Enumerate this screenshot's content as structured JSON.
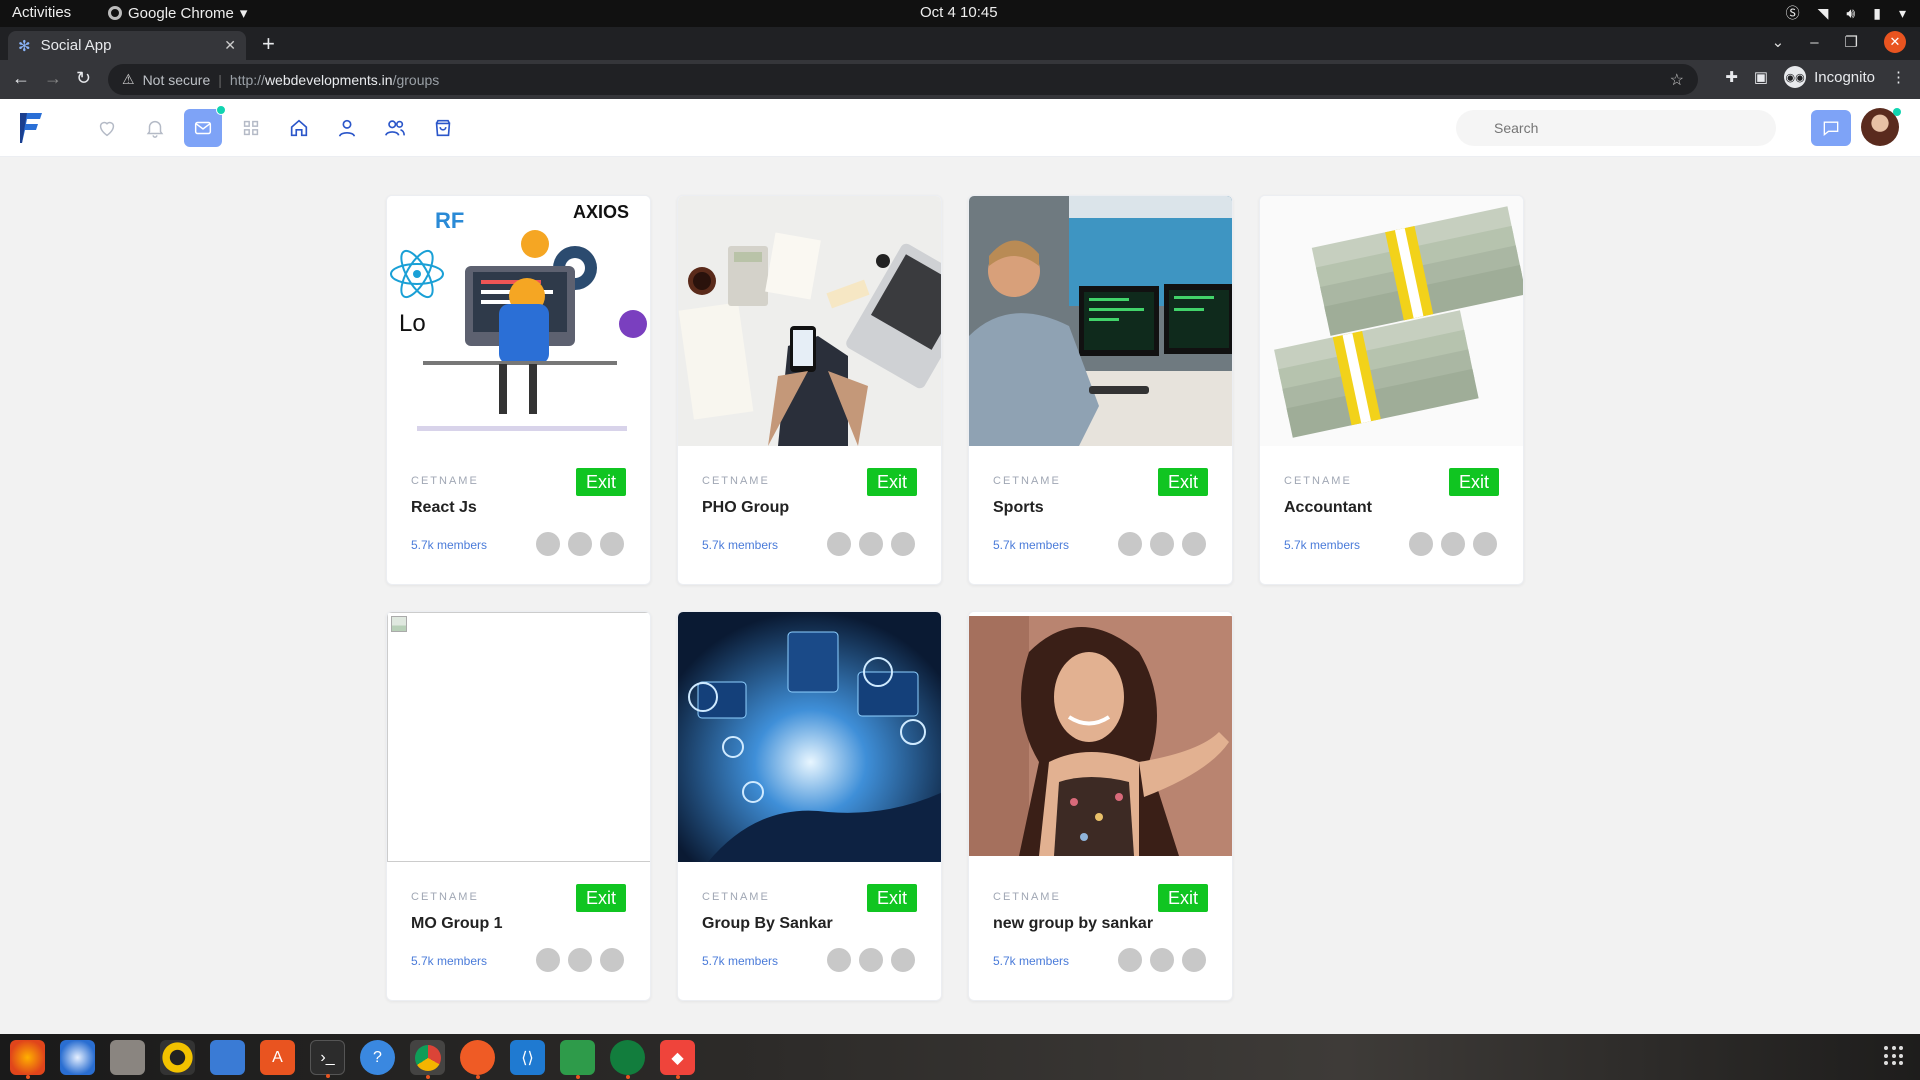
{
  "system": {
    "activities": "Activities",
    "app_name": "Google Chrome",
    "clock": "Oct 4  10:45"
  },
  "browser": {
    "tab_title": "Social App",
    "not_secure": "Not secure",
    "url_scheme": "http://",
    "url_host": "webdevelopments.in",
    "url_path": "/groups",
    "incognito_label": "Incognito"
  },
  "header": {
    "search_placeholder": "Search",
    "nav_icons": [
      "heart-icon",
      "bell-icon",
      "mail-icon",
      "grid-icon",
      "home-icon",
      "user-icon",
      "users-icon",
      "shopping-bag-icon"
    ],
    "active_nav": "mail-icon",
    "accent": "#7ea3f7",
    "online_dot": "#10d4b0"
  },
  "groups": [
    {
      "label": "CETNAME",
      "title": "React Js",
      "members": "5.7k members",
      "action": "Exit",
      "image": "react-illustration"
    },
    {
      "label": "CETNAME",
      "title": "PHO Group",
      "members": "5.7k members",
      "action": "Exit",
      "image": "desk-photo"
    },
    {
      "label": "CETNAME",
      "title": "Sports",
      "members": "5.7k members",
      "action": "Exit",
      "image": "programmer-photo"
    },
    {
      "label": "CETNAME",
      "title": "Accountant",
      "members": "5.7k members",
      "action": "Exit",
      "image": "money-photo"
    },
    {
      "label": "CETNAME",
      "title": "MO Group 1",
      "members": "5.7k members",
      "action": "Exit",
      "image": "broken-image"
    },
    {
      "label": "CETNAME",
      "title": "Group By Sankar",
      "members": "5.7k members",
      "action": "Exit",
      "image": "tech-hand-photo"
    },
    {
      "label": "CETNAME",
      "title": "new group by sankar",
      "members": "5.7k members",
      "action": "Exit",
      "image": "portrait-photo"
    }
  ],
  "colors": {
    "exit_button": "#10c521",
    "members_link": "#4a7bd9"
  },
  "dock": [
    "firefox-icon",
    "thunderbird-icon",
    "files-icon",
    "rhythmbox-icon",
    "writer-icon",
    "software-icon",
    "terminal-icon",
    "help-icon",
    "chrome-icon",
    "postman-icon",
    "vscode-icon",
    "calc-icon",
    "gitkraken-icon",
    "anydesk-icon"
  ]
}
